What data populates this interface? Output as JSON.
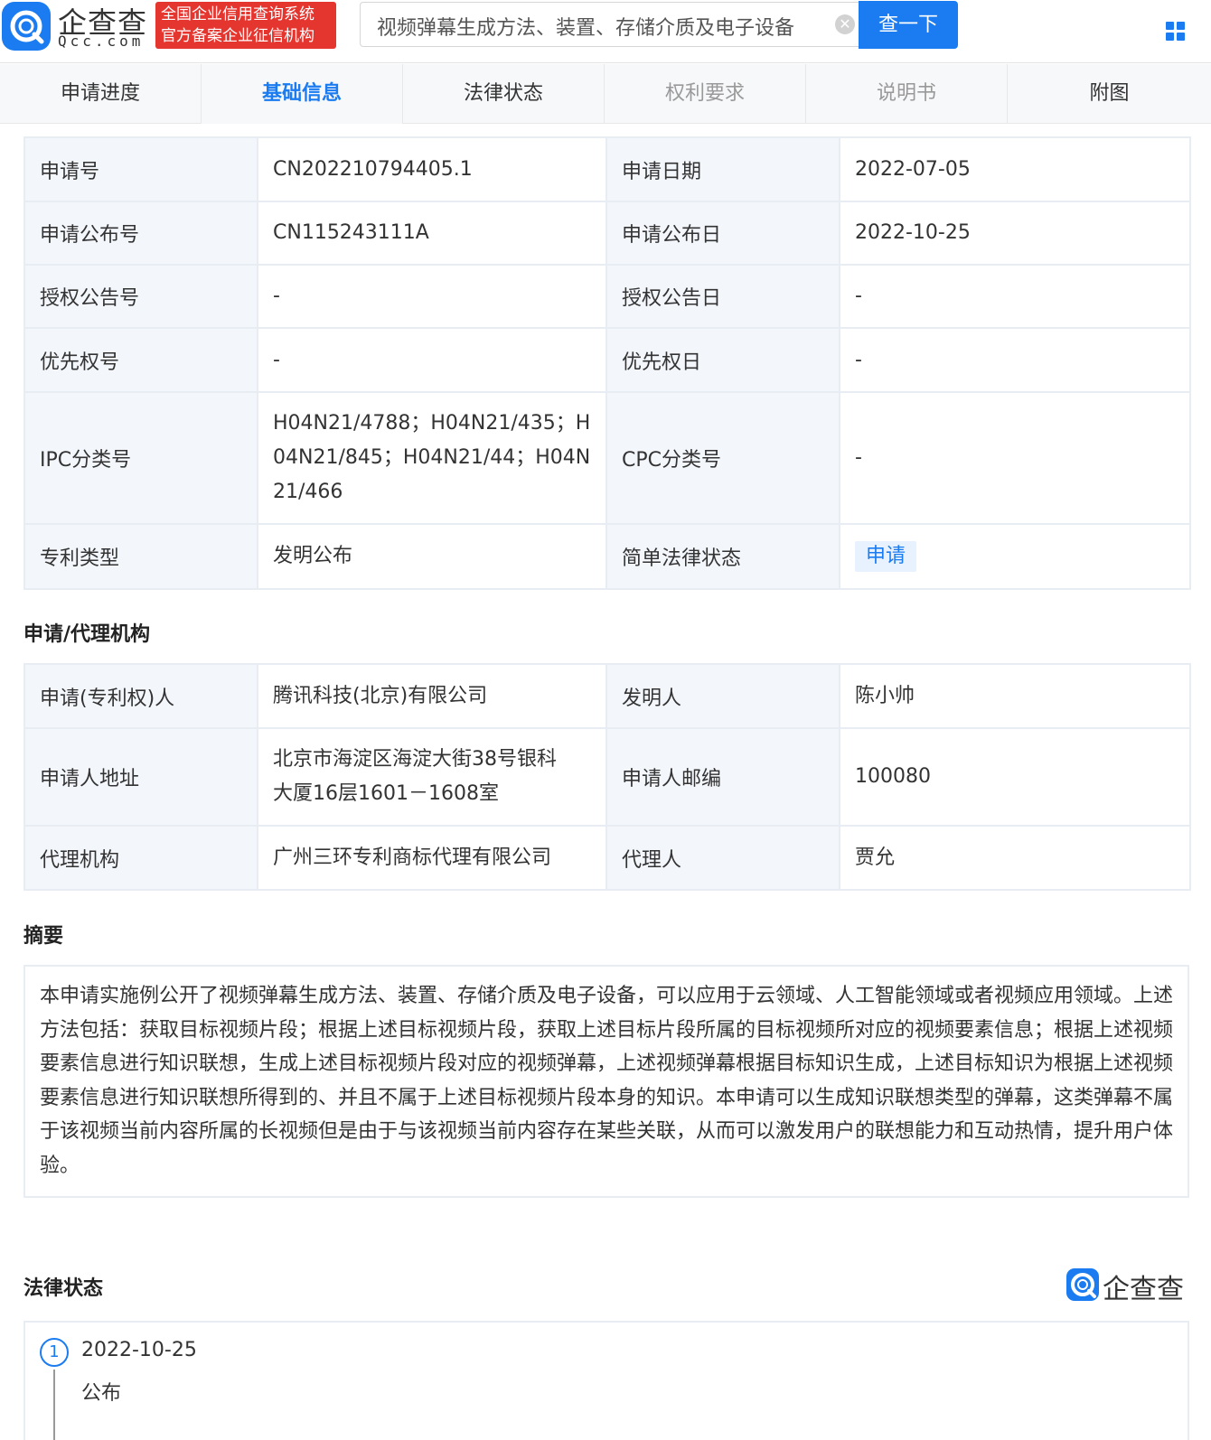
{
  "header": {
    "brand_name": "企查查",
    "brand_domain": "Qcc.com",
    "badge_line1": "全国企业信用查询系统",
    "badge_line2": "官方备案企业征信机构",
    "search_value": "视频弹幕生成方法、装置、存储介质及电子设备",
    "search_button": "查一下"
  },
  "tabs": [
    {
      "label": "申请进度"
    },
    {
      "label": "基础信息"
    },
    {
      "label": "法律状态"
    },
    {
      "label": "权利要求"
    },
    {
      "label": "说明书"
    },
    {
      "label": "附图"
    }
  ],
  "basic": {
    "app_no_label": "申请号",
    "app_no": "CN202210794405.1",
    "app_date_label": "申请日期",
    "app_date": "2022-07-05",
    "pub_no_label": "申请公布号",
    "pub_no": "CN115243111A",
    "pub_date_label": "申请公布日",
    "pub_date": "2022-10-25",
    "grant_no_label": "授权公告号",
    "grant_no": "-",
    "grant_date_label": "授权公告日",
    "grant_date": "-",
    "prio_no_label": "优先权号",
    "prio_no": "-",
    "prio_date_label": "优先权日",
    "prio_date": "-",
    "ipc_label": "IPC分类号",
    "ipc_line1": "H04N21/4788；H04N21/435；H",
    "ipc_line2": "04N21/845；H04N21/44；H04N",
    "ipc_line3": "21/466",
    "cpc_label": "CPC分类号",
    "cpc": "-",
    "type_label": "专利类型",
    "type": "发明公布",
    "status_label": "简单法律状态",
    "status": "申请"
  },
  "agency": {
    "title": "申请/代理机构",
    "applicant_label": "申请(专利权)人",
    "applicant": "腾讯科技(北京)有限公司",
    "inventor_label": "发明人",
    "inventor": "陈小帅",
    "address_label": "申请人地址",
    "address_line1": "北京市海淀区海淀大街38号银科",
    "address_line2": "大厦16层1601－1608室",
    "zip_label": "申请人邮编",
    "zip": "100080",
    "agency_label": "代理机构",
    "agency_name": "广州三环专利商标代理有限公司",
    "agent_label": "代理人",
    "agent": "贾允"
  },
  "abstract": {
    "title": "摘要",
    "text": "本申请实施例公开了视频弹幕生成方法、装置、存储介质及电子设备，可以应用于云领域、人工智能领域或者视频应用领域。上述方法包括：获取目标视频片段；根据上述目标视频片段，获取上述目标片段所属的目标视频所对应的视频要素信息；根据上述视频要素信息进行知识联想，生成上述目标视频片段对应的视频弹幕，上述视频弹幕根据目标知识生成，上述目标知识为根据上述视频要素信息进行知识联想所得到的、并且不属于上述目标视频片段本身的知识。本申请可以生成知识联想类型的弹幕，这类弹幕不属于该视频当前内容所属的长视频但是由于与该视频当前内容存在某些关联，从而可以激发用户的联想能力和互动热情，提升用户体验。"
  },
  "legal": {
    "title": "法律状态",
    "brand": "企查查",
    "events": [
      {
        "num": "1",
        "date": "2022-10-25",
        "text": "公布"
      }
    ]
  }
}
